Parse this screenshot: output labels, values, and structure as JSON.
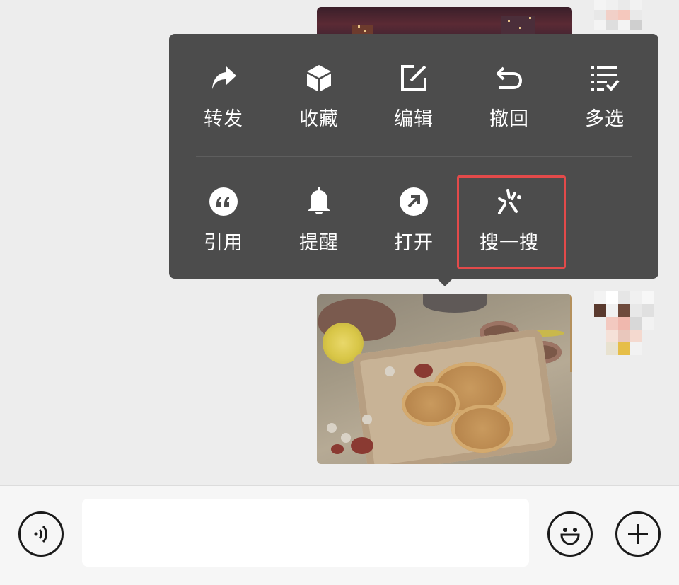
{
  "context_menu": {
    "items": [
      {
        "label": "转发",
        "icon": "forward-icon"
      },
      {
        "label": "收藏",
        "icon": "favorite-cube-icon"
      },
      {
        "label": "编辑",
        "icon": "edit-icon"
      },
      {
        "label": "撤回",
        "icon": "recall-undo-icon"
      },
      {
        "label": "多选",
        "icon": "multi-select-icon"
      },
      {
        "label": "引用",
        "icon": "quote-icon"
      },
      {
        "label": "提醒",
        "icon": "bell-icon"
      },
      {
        "label": "打开",
        "icon": "open-arrow-icon"
      },
      {
        "label": "搜一搜",
        "icon": "search-sparkle-icon"
      }
    ],
    "highlighted_item": "搜一搜",
    "highlight_color": "#e34a4a",
    "background_color": "#4c4c4c"
  },
  "input_bar": {
    "message_value": "",
    "icons": [
      "voice-icon",
      "emoji-icon",
      "plus-icon"
    ]
  }
}
